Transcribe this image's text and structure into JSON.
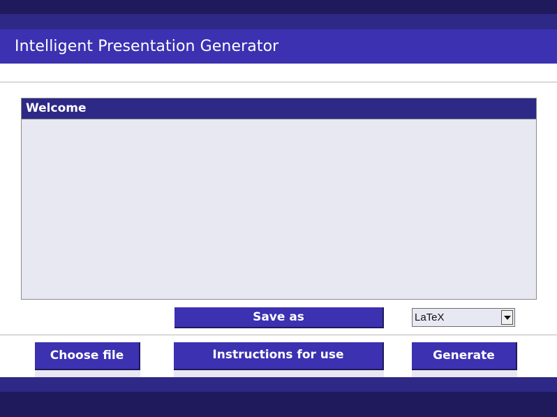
{
  "app": {
    "title": "Intelligent Presentation Generator"
  },
  "welcome_panel": {
    "header": "Welcome",
    "body_text": ""
  },
  "controls": {
    "save_as_label": "Save as",
    "format_select": {
      "selected": "LaTeX"
    },
    "choose_file_label": "Choose file",
    "instructions_label": "Instructions for use",
    "generate_label": "Generate"
  },
  "colors": {
    "primary": "#3c31b1",
    "dark": "#1e1a5b",
    "mid": "#2e2886",
    "panel_bg": "#e8e8f2"
  },
  "icons": {
    "dropdown": "chevron-down-icon"
  }
}
